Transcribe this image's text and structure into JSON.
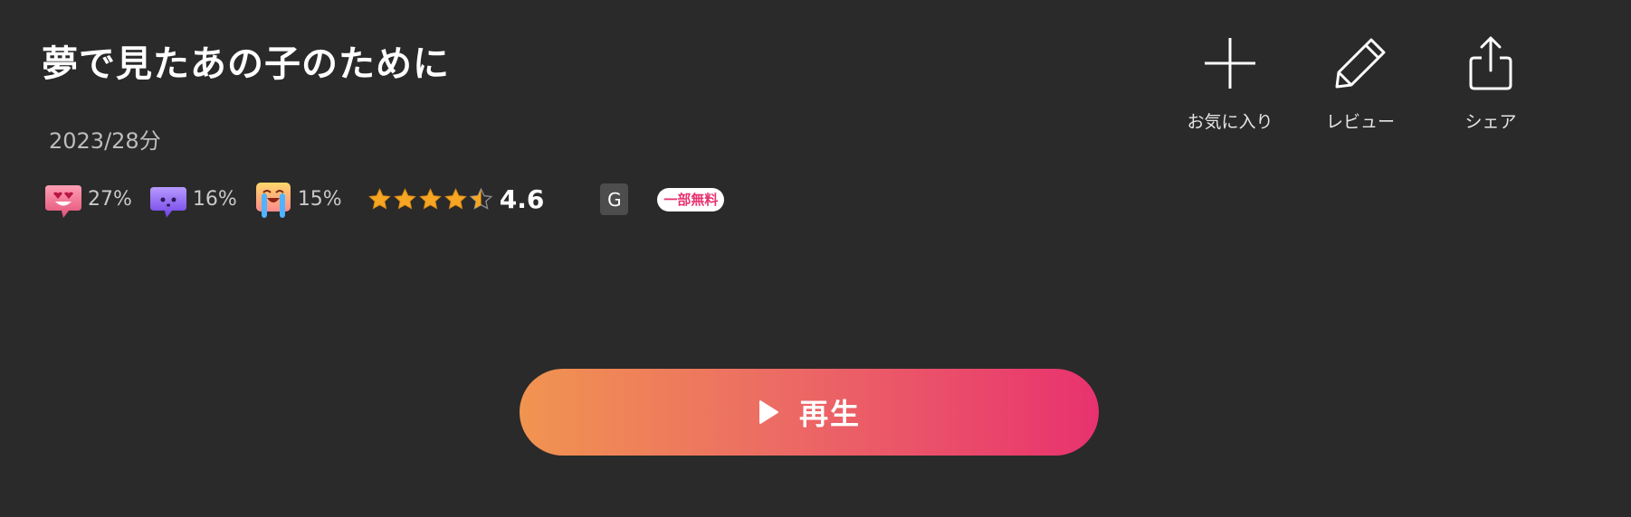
{
  "title": "夢で見たあの子のために",
  "meta": "2023/28分",
  "emotions": [
    {
      "name": "love",
      "percent": "27%"
    },
    {
      "name": "creepy",
      "percent": "16%"
    },
    {
      "name": "cry",
      "percent": "15%"
    }
  ],
  "rating": {
    "value": "4.6",
    "stars_filled": 4.5,
    "max": 5
  },
  "age_rating": "G",
  "free_badge": "一部無料",
  "actions": [
    {
      "icon": "plus-icon",
      "label": "お気に入り"
    },
    {
      "icon": "pencil-icon",
      "label": "レビュー"
    },
    {
      "icon": "share-icon",
      "label": "シェア"
    }
  ],
  "play_button": {
    "label": "再生"
  },
  "colors": {
    "background": "#2a2a2a",
    "accent_start": "#f19450",
    "accent_end": "#e8326f",
    "badge_text": "#e8336f",
    "star": "#f6a623"
  }
}
